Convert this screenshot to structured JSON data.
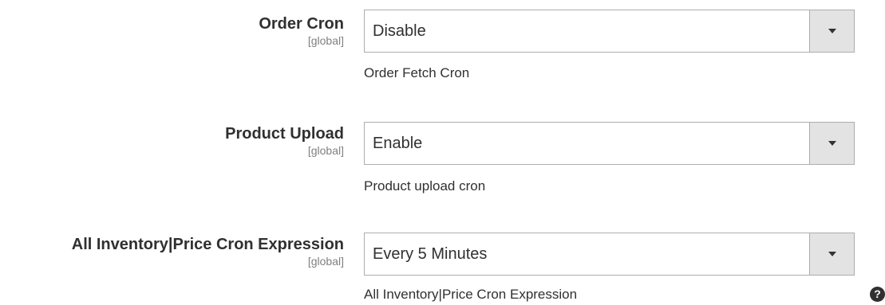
{
  "fields": [
    {
      "label": "Order Cron",
      "scope": "[global]",
      "value": "Disable",
      "note": "Order Fetch Cron"
    },
    {
      "label": "Product Upload",
      "scope": "[global]",
      "value": "Enable",
      "note": "Product upload cron"
    },
    {
      "label": "All Inventory|Price Cron Expression",
      "scope": "[global]",
      "value": "Every 5 Minutes",
      "note": "All Inventory|Price Cron Expression"
    }
  ],
  "help_icon": {
    "glyph": "?",
    "icon": "help-icon"
  }
}
